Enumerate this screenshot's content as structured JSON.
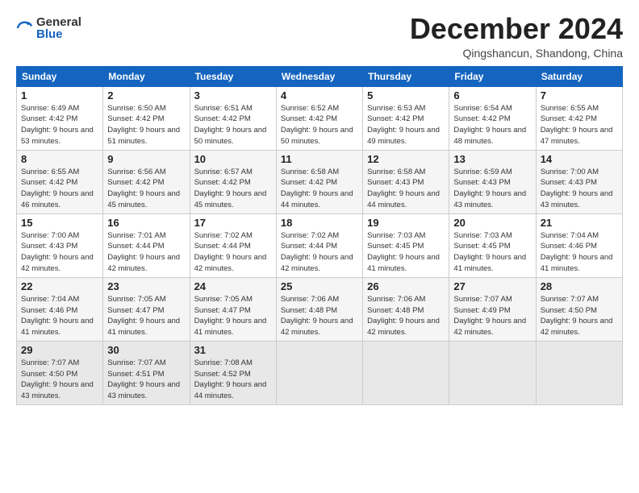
{
  "header": {
    "logo_general": "General",
    "logo_blue": "Blue",
    "month_title": "December 2024",
    "location": "Qingshancun, Shandong, China"
  },
  "weekdays": [
    "Sunday",
    "Monday",
    "Tuesday",
    "Wednesday",
    "Thursday",
    "Friday",
    "Saturday"
  ],
  "weeks": [
    [
      {
        "day": "1",
        "sunrise": "6:49 AM",
        "sunset": "4:42 PM",
        "daylight": "9 hours and 53 minutes."
      },
      {
        "day": "2",
        "sunrise": "6:50 AM",
        "sunset": "4:42 PM",
        "daylight": "9 hours and 51 minutes."
      },
      {
        "day": "3",
        "sunrise": "6:51 AM",
        "sunset": "4:42 PM",
        "daylight": "9 hours and 50 minutes."
      },
      {
        "day": "4",
        "sunrise": "6:52 AM",
        "sunset": "4:42 PM",
        "daylight": "9 hours and 50 minutes."
      },
      {
        "day": "5",
        "sunrise": "6:53 AM",
        "sunset": "4:42 PM",
        "daylight": "9 hours and 49 minutes."
      },
      {
        "day": "6",
        "sunrise": "6:54 AM",
        "sunset": "4:42 PM",
        "daylight": "9 hours and 48 minutes."
      },
      {
        "day": "7",
        "sunrise": "6:55 AM",
        "sunset": "4:42 PM",
        "daylight": "9 hours and 47 minutes."
      }
    ],
    [
      {
        "day": "8",
        "sunrise": "6:55 AM",
        "sunset": "4:42 PM",
        "daylight": "9 hours and 46 minutes."
      },
      {
        "day": "9",
        "sunrise": "6:56 AM",
        "sunset": "4:42 PM",
        "daylight": "9 hours and 45 minutes."
      },
      {
        "day": "10",
        "sunrise": "6:57 AM",
        "sunset": "4:42 PM",
        "daylight": "9 hours and 45 minutes."
      },
      {
        "day": "11",
        "sunrise": "6:58 AM",
        "sunset": "4:42 PM",
        "daylight": "9 hours and 44 minutes."
      },
      {
        "day": "12",
        "sunrise": "6:58 AM",
        "sunset": "4:43 PM",
        "daylight": "9 hours and 44 minutes."
      },
      {
        "day": "13",
        "sunrise": "6:59 AM",
        "sunset": "4:43 PM",
        "daylight": "9 hours and 43 minutes."
      },
      {
        "day": "14",
        "sunrise": "7:00 AM",
        "sunset": "4:43 PM",
        "daylight": "9 hours and 43 minutes."
      }
    ],
    [
      {
        "day": "15",
        "sunrise": "7:00 AM",
        "sunset": "4:43 PM",
        "daylight": "9 hours and 42 minutes."
      },
      {
        "day": "16",
        "sunrise": "7:01 AM",
        "sunset": "4:44 PM",
        "daylight": "9 hours and 42 minutes."
      },
      {
        "day": "17",
        "sunrise": "7:02 AM",
        "sunset": "4:44 PM",
        "daylight": "9 hours and 42 minutes."
      },
      {
        "day": "18",
        "sunrise": "7:02 AM",
        "sunset": "4:44 PM",
        "daylight": "9 hours and 42 minutes."
      },
      {
        "day": "19",
        "sunrise": "7:03 AM",
        "sunset": "4:45 PM",
        "daylight": "9 hours and 41 minutes."
      },
      {
        "day": "20",
        "sunrise": "7:03 AM",
        "sunset": "4:45 PM",
        "daylight": "9 hours and 41 minutes."
      },
      {
        "day": "21",
        "sunrise": "7:04 AM",
        "sunset": "4:46 PM",
        "daylight": "9 hours and 41 minutes."
      }
    ],
    [
      {
        "day": "22",
        "sunrise": "7:04 AM",
        "sunset": "4:46 PM",
        "daylight": "9 hours and 41 minutes."
      },
      {
        "day": "23",
        "sunrise": "7:05 AM",
        "sunset": "4:47 PM",
        "daylight": "9 hours and 41 minutes."
      },
      {
        "day": "24",
        "sunrise": "7:05 AM",
        "sunset": "4:47 PM",
        "daylight": "9 hours and 41 minutes."
      },
      {
        "day": "25",
        "sunrise": "7:06 AM",
        "sunset": "4:48 PM",
        "daylight": "9 hours and 42 minutes."
      },
      {
        "day": "26",
        "sunrise": "7:06 AM",
        "sunset": "4:48 PM",
        "daylight": "9 hours and 42 minutes."
      },
      {
        "day": "27",
        "sunrise": "7:07 AM",
        "sunset": "4:49 PM",
        "daylight": "9 hours and 42 minutes."
      },
      {
        "day": "28",
        "sunrise": "7:07 AM",
        "sunset": "4:50 PM",
        "daylight": "9 hours and 42 minutes."
      }
    ],
    [
      {
        "day": "29",
        "sunrise": "7:07 AM",
        "sunset": "4:50 PM",
        "daylight": "9 hours and 43 minutes."
      },
      {
        "day": "30",
        "sunrise": "7:07 AM",
        "sunset": "4:51 PM",
        "daylight": "9 hours and 43 minutes."
      },
      {
        "day": "31",
        "sunrise": "7:08 AM",
        "sunset": "4:52 PM",
        "daylight": "9 hours and 44 minutes."
      },
      null,
      null,
      null,
      null
    ]
  ]
}
